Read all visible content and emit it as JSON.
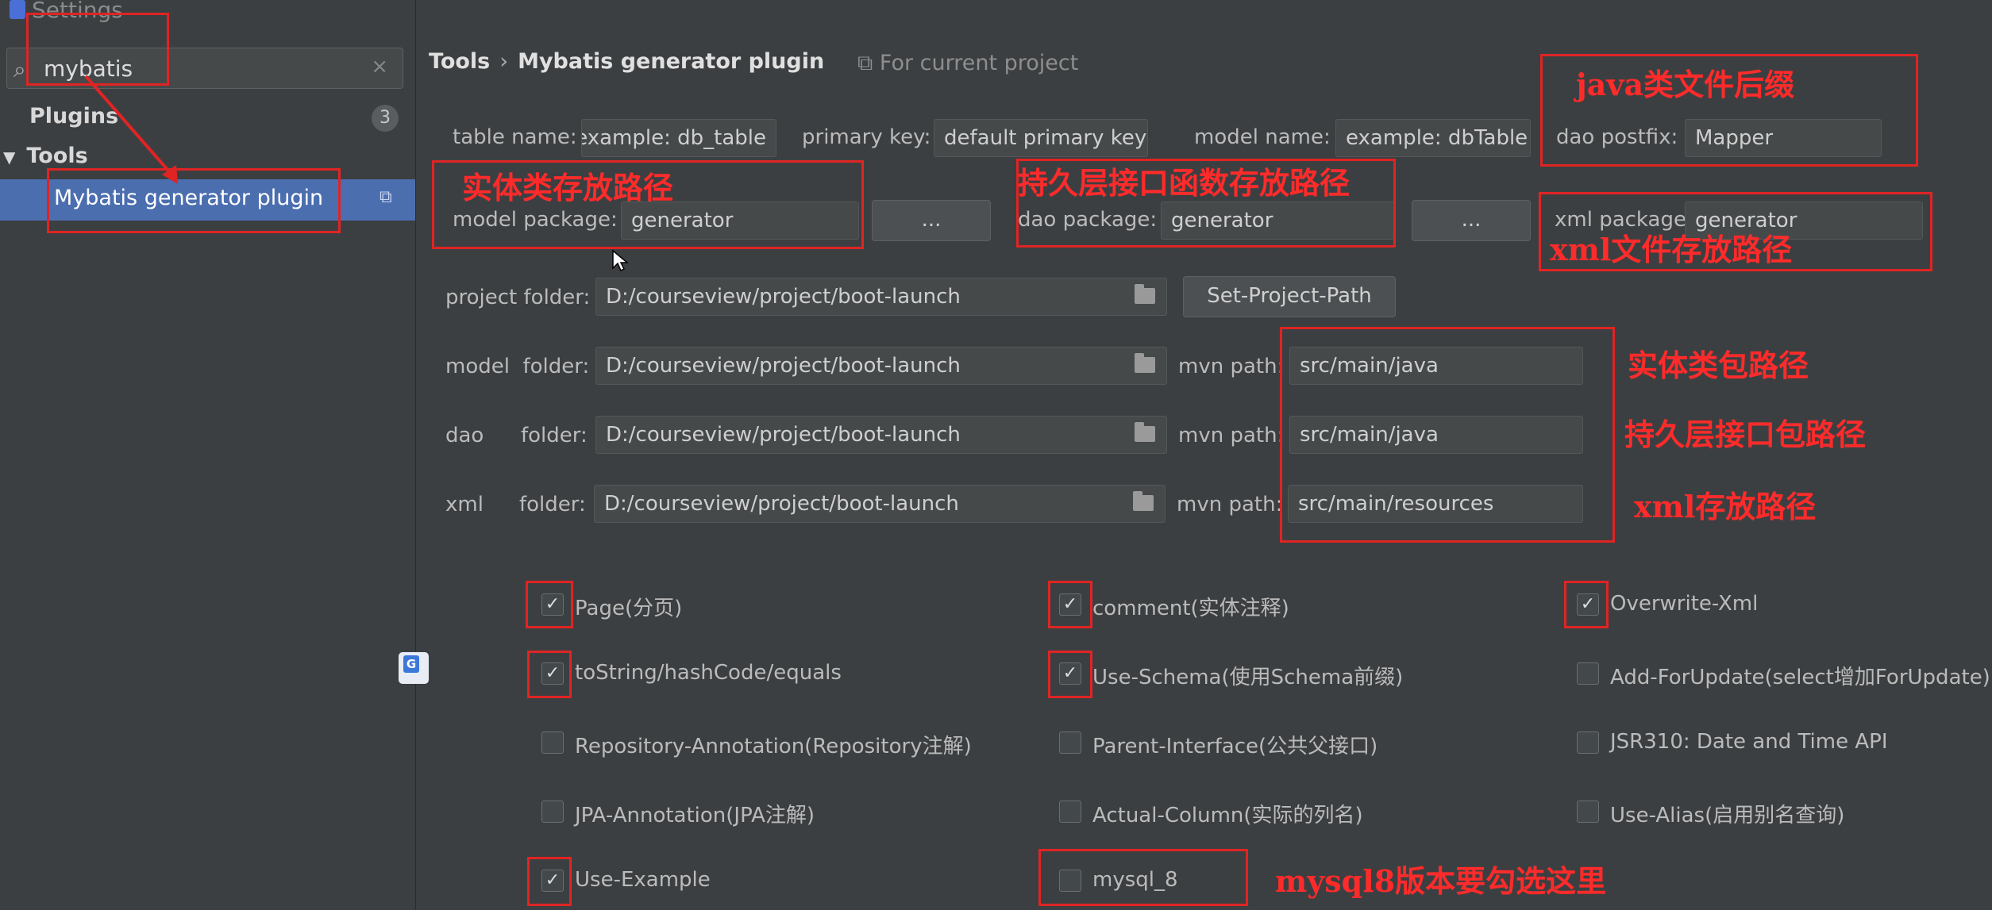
{
  "window": {
    "title": "Settings"
  },
  "sidebar": {
    "search_value": "mybatis",
    "search_clear": "×",
    "items": [
      {
        "label": "Plugins",
        "badge": "3"
      },
      {
        "label": "Tools",
        "expanded": true
      },
      {
        "label": "Mybatis generator plugin",
        "selected": true
      }
    ]
  },
  "header": {
    "breadcrumb_parent": "Tools",
    "breadcrumb_separator": "›",
    "breadcrumb_current": "Mybatis generator plugin",
    "scope": "For current project"
  },
  "form": {
    "table_name_label": "table name:",
    "table_name_value": "example: db_table",
    "primary_key_label": "primary key:",
    "primary_key_value": "default primary key",
    "model_name_label": "model name:",
    "model_name_value": "example: dbTable",
    "dao_postfix_label": "dao postfix:",
    "dao_postfix_value": "Mapper",
    "model_package_label": "model package:",
    "model_package_value": "generator",
    "dao_package_label": "dao package:",
    "dao_package_value": "generator",
    "xml_package_label": "xml package:",
    "xml_package_value": "generator",
    "browse_label": "...",
    "project_folder_label": "project folder:",
    "project_folder_value": "D:/courseview/project/boot-launch",
    "set_project_path_label": "Set-Project-Path",
    "model_folder_label_a": "model",
    "dao_folder_label_a": "dao",
    "xml_folder_label_a": "xml",
    "folder_label": "folder:",
    "model_folder_value": "D:/courseview/project/boot-launch",
    "dao_folder_value": "D:/courseview/project/boot-launch",
    "xml_folder_value": "D:/courseview/project/boot-launch",
    "mvn_path_label": "mvn path:",
    "model_mvn_path": "src/main/java",
    "dao_mvn_path": "src/main/java",
    "xml_mvn_path": "src/main/resources"
  },
  "options": [
    {
      "label": "Page(分页)",
      "checked": true
    },
    {
      "label": "comment(实体注释)",
      "checked": true
    },
    {
      "label": "Overwrite-Xml",
      "checked": true
    },
    {
      "label": "toString/hashCode/equals",
      "checked": true
    },
    {
      "label": "Use-Schema(使用Schema前缀)",
      "checked": true
    },
    {
      "label": "Add-ForUpdate(select增加ForUpdate)",
      "checked": false
    },
    {
      "label": "Repository-Annotation(Repository注解)",
      "checked": false
    },
    {
      "label": "Parent-Interface(公共父接口)",
      "checked": false
    },
    {
      "label": "JSR310: Date and Time API",
      "checked": false
    },
    {
      "label": "JPA-Annotation(JPA注解)",
      "checked": false
    },
    {
      "label": "Actual-Column(实际的列名)",
      "checked": false
    },
    {
      "label": "Use-Alias(启用别名查询)",
      "checked": false
    },
    {
      "label": "Use-Example",
      "checked": true
    },
    {
      "label": "mysql_8",
      "checked": false
    }
  ],
  "annotations": {
    "java_suffix": "java类文件后缀",
    "entity_path": "实体类存放路径",
    "dao_func_path": "持久层接口函数存放路径",
    "xml_file_path": "xml文件存放路径",
    "entity_pkg_path": "实体类包路径",
    "dao_pkg_path": "持久层接口包路径",
    "xml_store_path": "xml存放路径",
    "mysql8_note": "mysql8版本要勾选这里",
    "color": "#e02424"
  },
  "colors": {
    "background": "#3c3f41",
    "selection": "#4b6eaf",
    "field": "#45494a"
  }
}
